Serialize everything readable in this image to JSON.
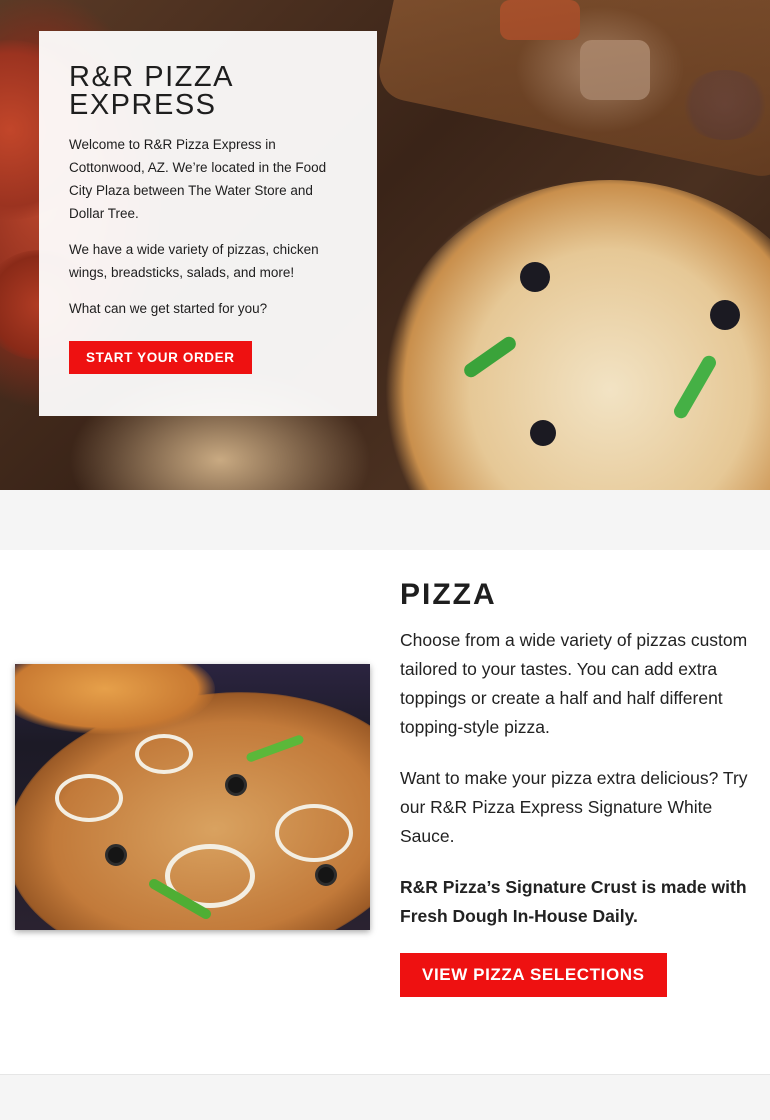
{
  "hero": {
    "title": "R&R PIZZA EXPRESS",
    "paragraphs": [
      "Welcome to R&R Pizza Express in Cottonwood, AZ. We’re located in the Food City Plaza between The Water Store and Dollar Tree.",
      "We have a wide variety of pizzas, chicken wings, breadsticks, salads, and more!",
      "What can we get started for you?"
    ],
    "button_label": "START YOUR ORDER"
  },
  "pizza": {
    "title": "PIZZA",
    "paragraphs": [
      "Choose from a wide variety of pizzas custom tailored to your tastes. You can add extra toppings or create a half and half different topping-style pizza.",
      "Want to make your pizza extra delicious? Try our R&R Pizza Express Signature White Sauce."
    ],
    "bold_text": "R&R Pizza’s Signature Crust is made with Fresh Dough In-House Daily.",
    "button_label": "VIEW PIZZA SELECTIONS"
  },
  "colors": {
    "accent": "#ee1111",
    "background": "#f5f5f5",
    "card": "#ffffff"
  }
}
